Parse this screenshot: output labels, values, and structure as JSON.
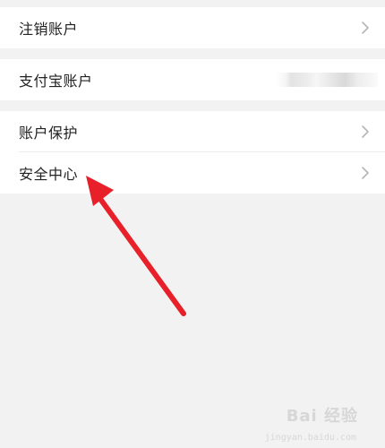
{
  "settings": {
    "group1": {
      "deregister_label": "注销账户"
    },
    "group2": {
      "alipay_label": "支付宝账户"
    },
    "group3": {
      "account_protection_label": "账户保护",
      "security_center_label": "安全中心"
    }
  },
  "icons": {
    "chevron": "chevron-right-icon"
  },
  "colors": {
    "background": "#f2f2f2",
    "card": "#ffffff",
    "text": "#222222",
    "chevron": "#b5b5b5",
    "arrow": "#e8202a"
  },
  "watermark": {
    "brand": "Bai 经验",
    "url": "jingyan.baidu.com"
  }
}
